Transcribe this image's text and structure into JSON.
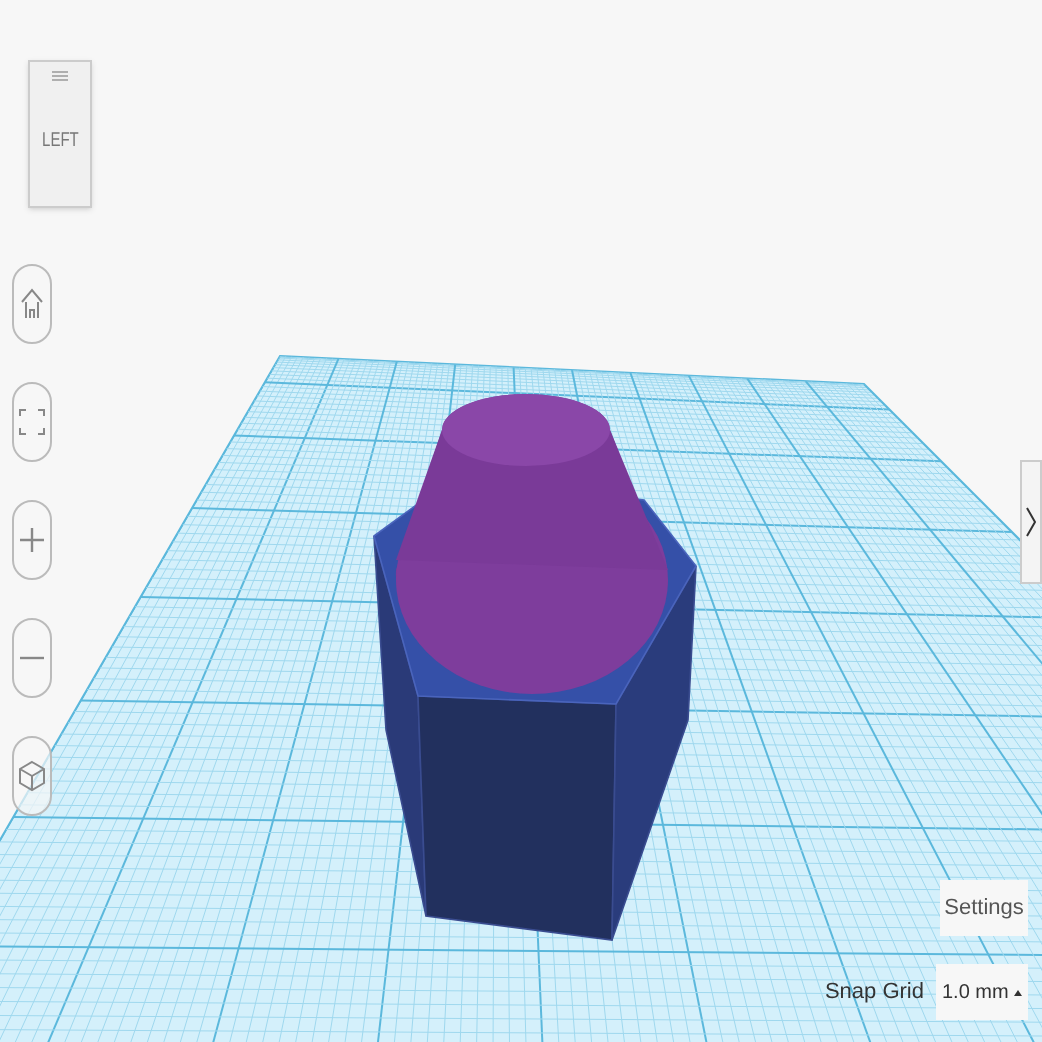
{
  "view_cube": {
    "face_label": "LEFT"
  },
  "view_controls": [
    {
      "kind": "home"
    },
    {
      "kind": "fit"
    },
    {
      "kind": "zoom_in"
    },
    {
      "kind": "zoom_out"
    },
    {
      "kind": "perspective"
    }
  ],
  "settings_button": "Settings",
  "snap_grid": {
    "label": "Snap Grid",
    "value": "1.0 mm"
  }
}
